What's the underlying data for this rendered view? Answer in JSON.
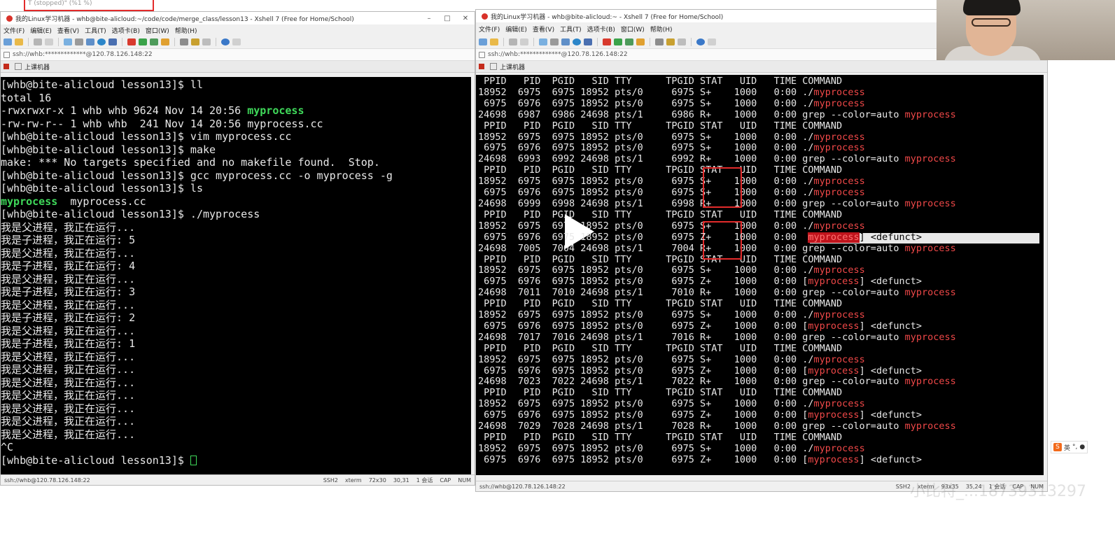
{
  "background_tab": {
    "text": "T  (stopped)\"         (%1 %)"
  },
  "left_window": {
    "title": "我的Linux学习机器 - whb@bite-alicloud:~/code/code/merge_class/lesson13 - Xshell 7 (Free for Home/School)",
    "menu": [
      "文件(F)",
      "编辑(E)",
      "查看(V)",
      "工具(T)",
      "选项卡(B)",
      "窗口(W)",
      "帮助(H)"
    ],
    "address": "ssh://whb:*************@120.78.126.148:22",
    "tab_label": "上课机器",
    "status": {
      "connection": "ssh://whb@120.78.126.148:22",
      "protocol": "SSH2",
      "term": "xterm",
      "size": "72x30",
      "cursor": "30,31",
      "sessions": "1 会话",
      "caps": "CAP",
      "num": "NUM"
    },
    "terminal_lines": [
      [
        {
          "t": "[whb@bite-alicloud lesson13]$ ll"
        }
      ],
      [
        {
          "t": "total 16"
        }
      ],
      [
        {
          "t": "-rwxrwxr-x 1 whb whb 9624 Nov 14 20:56 "
        },
        {
          "t": "myprocess",
          "c": "g"
        }
      ],
      [
        {
          "t": "-rw-rw-r-- 1 whb whb  241 Nov 14 20:56 myprocess.cc"
        }
      ],
      [
        {
          "t": "[whb@bite-alicloud lesson13]$ vim myprocess.cc"
        }
      ],
      [
        {
          "t": "[whb@bite-alicloud lesson13]$ make"
        }
      ],
      [
        {
          "t": "make: *** No targets specified and no makefile found.  Stop."
        }
      ],
      [
        {
          "t": "[whb@bite-alicloud lesson13]$ gcc myprocess.cc -o myprocess -g"
        }
      ],
      [
        {
          "t": "[whb@bite-alicloud lesson13]$ ls"
        }
      ],
      [
        {
          "t": "myprocess",
          "c": "g"
        },
        {
          "t": "  myprocess.cc"
        }
      ],
      [
        {
          "t": "[whb@bite-alicloud lesson13]$ ./myprocess"
        }
      ],
      [
        {
          "t": "我是父进程，我正在运行..."
        }
      ],
      [
        {
          "t": "我是子进程，我正在运行: 5"
        }
      ],
      [
        {
          "t": "我是父进程，我正在运行..."
        }
      ],
      [
        {
          "t": "我是子进程，我正在运行: 4"
        }
      ],
      [
        {
          "t": "我是父进程，我正在运行..."
        }
      ],
      [
        {
          "t": "我是子进程，我正在运行: 3"
        }
      ],
      [
        {
          "t": "我是父进程，我正在运行..."
        }
      ],
      [
        {
          "t": "我是子进程，我正在运行: 2"
        }
      ],
      [
        {
          "t": "我是父进程，我正在运行..."
        }
      ],
      [
        {
          "t": "我是子进程，我正在运行: 1"
        }
      ],
      [
        {
          "t": "我是父进程，我正在运行..."
        }
      ],
      [
        {
          "t": "我是父进程，我正在运行..."
        }
      ],
      [
        {
          "t": "我是父进程，我正在运行..."
        }
      ],
      [
        {
          "t": "我是父进程，我正在运行..."
        }
      ],
      [
        {
          "t": "我是父进程，我正在运行..."
        }
      ],
      [
        {
          "t": "我是父进程，我正在运行..."
        }
      ],
      [
        {
          "t": "我是父进程，我正在运行..."
        }
      ],
      [
        {
          "t": "^C"
        }
      ],
      [
        {
          "t": "[whb@bite-alicloud lesson13]$ "
        },
        {
          "cursor": true
        }
      ]
    ]
  },
  "right_window": {
    "title": "我的Linux学习机器 - whb@bite-alicloud:~ - Xshell 7 (Free for Home/School)",
    "menu": [
      "文件(F)",
      "编辑(E)",
      "查看(V)",
      "工具(T)",
      "选项卡(B)",
      "窗口(W)",
      "帮助(H)"
    ],
    "address": "ssh://whb:*************@120.78.126.148:22",
    "tab_label": "上课机器",
    "status": {
      "connection": "ssh://whb@120.78.126.148:22",
      "protocol": "SSH2",
      "term": "xterm",
      "size": "93x35",
      "cursor": "35,24",
      "sessions": "1 会话",
      "caps": "CAP",
      "num": "NUM"
    },
    "terminal_lines": [
      [
        {
          "t": " PPID   PID  PGID   SID TTY      TPGID STAT   UID   TIME COMMAND"
        }
      ],
      [
        {
          "t": "18952  6975  6975 18952 pts/0     6975 S+    1000   0:00 ./"
        },
        {
          "t": "myprocess",
          "c": "r"
        }
      ],
      [
        {
          "t": " 6975  6976  6975 18952 pts/0     6975 S+    1000   0:00 ./"
        },
        {
          "t": "myprocess",
          "c": "r"
        }
      ],
      [
        {
          "t": "24698  6987  6986 24698 pts/1     6986 R+    1000   0:00 grep --color=auto "
        },
        {
          "t": "myprocess",
          "c": "r"
        }
      ],
      [
        {
          "t": " PPID   PID  PGID   SID TTY      TPGID STAT   UID   TIME COMMAND"
        }
      ],
      [
        {
          "t": "18952  6975  6975 18952 pts/0     6975 S+    1000   0:00 ./"
        },
        {
          "t": "myprocess",
          "c": "r"
        }
      ],
      [
        {
          "t": " 6975  6976  6975 18952 pts/0     6975 S+    1000   0:00 ./"
        },
        {
          "t": "myprocess",
          "c": "r"
        }
      ],
      [
        {
          "t": "24698  6993  6992 24698 pts/1     6992 R+    1000   0:00 grep --color=auto "
        },
        {
          "t": "myprocess",
          "c": "r"
        }
      ],
      [
        {
          "t": " PPID   PID  PGID   SID TTY      TPGID STAT   UID   TIME COMMAND"
        }
      ],
      [
        {
          "t": "18952  6975  6975 18952 pts/0     6975 S+    1000   0:00 ./"
        },
        {
          "t": "myprocess",
          "c": "r"
        }
      ],
      [
        {
          "t": " 6975  6976  6975 18952 pts/0     6975 S+    1000   0:00 ./"
        },
        {
          "t": "myprocess",
          "c": "r"
        }
      ],
      [
        {
          "t": "24698  6999  6998 24698 pts/1     6998 R+    1000   0:00 grep --color=auto "
        },
        {
          "t": "myprocess",
          "c": "r"
        }
      ],
      [
        {
          "t": " PPID   PID  PGID   SID TTY      TPGID STAT   UID   TIME COMMAND"
        }
      ],
      [
        {
          "t": "18952  6975  6975 18952 pts/0     6975 S+    1000   0:00 ./"
        },
        {
          "t": "myprocess",
          "c": "r"
        }
      ],
      [
        {
          "t": " 6975  6976  6975 18952 pts/0     6975 Z+    1000   0:00 [",
          "hl": true
        },
        {
          "t": "myprocess",
          "c": "hlp"
        },
        {
          "t": "] <defunct>",
          "hl": true
        }
      ],
      [
        {
          "t": "24698  7005  7004 24698 pts/1     7004 R+    1000   0:00 grep --color=auto "
        },
        {
          "t": "myprocess",
          "c": "r"
        }
      ],
      [
        {
          "t": " PPID   PID  PGID   SID TTY      TPGID STAT   UID   TIME COMMAND"
        }
      ],
      [
        {
          "t": "18952  6975  6975 18952 pts/0     6975 S+    1000   0:00 ./"
        },
        {
          "t": "myprocess",
          "c": "r"
        }
      ],
      [
        {
          "t": " 6975  6976  6975 18952 pts/0     6975 Z+    1000   0:00 ["
        },
        {
          "t": "myprocess",
          "c": "r"
        },
        {
          "t": "] <defunct>"
        }
      ],
      [
        {
          "t": "24698  7011  7010 24698 pts/1     7010 R+    1000   0:00 grep --color=auto "
        },
        {
          "t": "myprocess",
          "c": "r"
        }
      ],
      [
        {
          "t": " PPID   PID  PGID   SID TTY      TPGID STAT   UID   TIME COMMAND"
        }
      ],
      [
        {
          "t": "18952  6975  6975 18952 pts/0     6975 S+    1000   0:00 ./"
        },
        {
          "t": "myprocess",
          "c": "r"
        }
      ],
      [
        {
          "t": " 6975  6976  6975 18952 pts/0     6975 Z+    1000   0:00 ["
        },
        {
          "t": "myprocess",
          "c": "r"
        },
        {
          "t": "] <defunct>"
        }
      ],
      [
        {
          "t": "24698  7017  7016 24698 pts/1     7016 R+    1000   0:00 grep --color=auto "
        },
        {
          "t": "myprocess",
          "c": "r"
        }
      ],
      [
        {
          "t": " PPID   PID  PGID   SID TTY      TPGID STAT   UID   TIME COMMAND"
        }
      ],
      [
        {
          "t": "18952  6975  6975 18952 pts/0     6975 S+    1000   0:00 ./"
        },
        {
          "t": "myprocess",
          "c": "r"
        }
      ],
      [
        {
          "t": " 6975  6976  6975 18952 pts/0     6975 Z+    1000   0:00 ["
        },
        {
          "t": "myprocess",
          "c": "r"
        },
        {
          "t": "] <defunct>"
        }
      ],
      [
        {
          "t": "24698  7023  7022 24698 pts/1     7022 R+    1000   0:00 grep --color=auto "
        },
        {
          "t": "myprocess",
          "c": "r"
        }
      ],
      [
        {
          "t": " PPID   PID  PGID   SID TTY      TPGID STAT   UID   TIME COMMAND"
        }
      ],
      [
        {
          "t": "18952  6975  6975 18952 pts/0     6975 S+    1000   0:00 ./"
        },
        {
          "t": "myprocess",
          "c": "r"
        }
      ],
      [
        {
          "t": " 6975  6976  6975 18952 pts/0     6975 Z+    1000   0:00 ["
        },
        {
          "t": "myprocess",
          "c": "r"
        },
        {
          "t": "] <defunct>"
        }
      ],
      [
        {
          "t": "24698  7029  7028 24698 pts/1     7028 R+    1000   0:00 grep --color=auto "
        },
        {
          "t": "myprocess",
          "c": "r"
        }
      ],
      [
        {
          "t": " PPID   PID  PGID   SID TTY      TPGID STAT   UID   TIME COMMAND"
        }
      ],
      [
        {
          "t": "18952  6975  6975 18952 pts/0     6975 S+    1000   0:00 ./"
        },
        {
          "t": "myprocess",
          "c": "r"
        }
      ],
      [
        {
          "t": " 6975  6976  6975 18952 pts/0     6975 Z+    1000   0:00 ["
        },
        {
          "t": "myprocess",
          "c": "r"
        },
        {
          "t": "] <defunct>"
        }
      ]
    ]
  },
  "ime": {
    "mode_label": "英"
  },
  "watermark": {
    "text": "小比特_...18739313297"
  },
  "colors": {
    "terminal_bg": "#000000",
    "terminal_fg": "#e8e8e8",
    "exec_green": "#3fd95a",
    "match_red": "#f04848",
    "annotation_red": "#e32b2b"
  }
}
